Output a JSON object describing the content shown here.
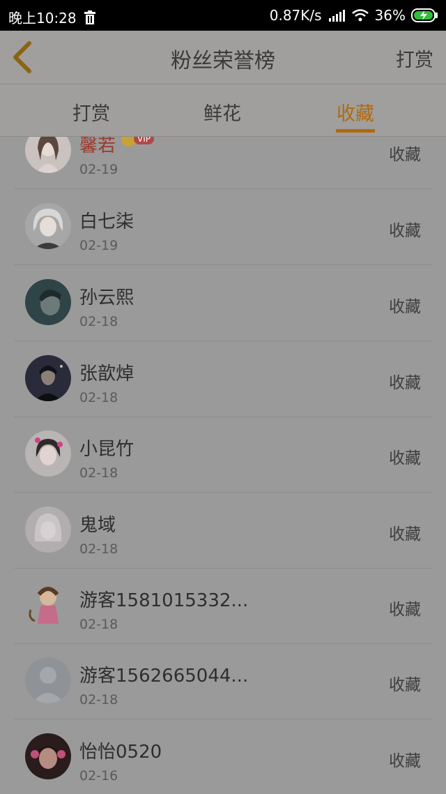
{
  "status_bar": {
    "time": "晚上10:28",
    "speed": "0.87K/s",
    "battery": "36%"
  },
  "header": {
    "title": "粉丝荣誉榜",
    "action": "打赏"
  },
  "tabs": [
    {
      "label": "打赏",
      "active": false
    },
    {
      "label": "鲜花",
      "active": false
    },
    {
      "label": "收藏",
      "active": true
    }
  ],
  "rows": [
    {
      "name": "馨若",
      "date": "02-19",
      "action": "收藏",
      "vip": "VIP"
    },
    {
      "name": "白七柒",
      "date": "02-19",
      "action": "收藏"
    },
    {
      "name": "孙云熙",
      "date": "02-18",
      "action": "收藏"
    },
    {
      "name": "张歆焯",
      "date": "02-18",
      "action": "收藏"
    },
    {
      "name": "小昆竹",
      "date": "02-18",
      "action": "收藏"
    },
    {
      "name": "鬼域",
      "date": "02-18",
      "action": "收藏"
    },
    {
      "name": "游客1581015332...",
      "date": "02-18",
      "action": "收藏"
    },
    {
      "name": "游客1562665044...",
      "date": "02-18",
      "action": "收藏"
    },
    {
      "name": "怡怡0520",
      "date": "02-16",
      "action": "收藏"
    }
  ],
  "colors": {
    "accent": "#b06a10",
    "overlay_bg": "#9a9a9a"
  },
  "icons": {
    "back": "chevron-left-icon",
    "trash": "trash-icon",
    "signal": "signal-icon",
    "wifi": "wifi-icon",
    "battery": "battery-charging-icon"
  }
}
